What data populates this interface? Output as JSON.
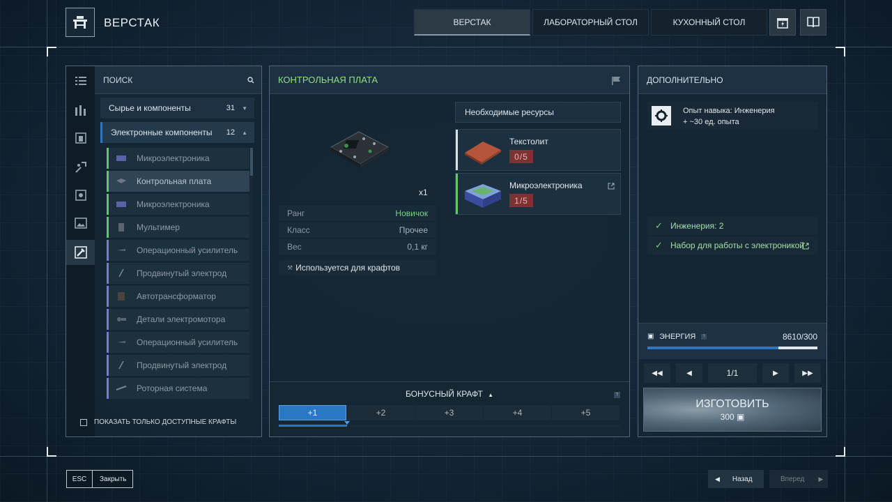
{
  "header": {
    "title": "ВЕРСТАК",
    "tabs": [
      {
        "label": "ВЕРСТАК",
        "active": true
      },
      {
        "label": "ЛАБОРАТОРНЫЙ СТОЛ",
        "active": false
      },
      {
        "label": "КУХОННЫЙ СТОЛ",
        "active": false
      }
    ],
    "icons": [
      "gift-energy-icon",
      "book-icon"
    ]
  },
  "left_panel": {
    "search_label": "ПОИСК",
    "categories": [
      {
        "label": "Сырье и компоненты",
        "count": "31",
        "expanded": false
      },
      {
        "label": "Электронные компоненты",
        "count": "12",
        "expanded": true
      }
    ],
    "items": [
      {
        "label": "Микроэлектроника",
        "rarity": "green",
        "selected": false
      },
      {
        "label": "Контрольная плата",
        "rarity": "green",
        "selected": true
      },
      {
        "label": "Микроэлектроника",
        "rarity": "green",
        "selected": false
      },
      {
        "label": "Мультимер",
        "rarity": "green",
        "selected": false
      },
      {
        "label": "Операционный усилитель",
        "rarity": "blue",
        "selected": false
      },
      {
        "label": "Продвинутый электрод",
        "rarity": "blue",
        "selected": false
      },
      {
        "label": "Автотрансформатор",
        "rarity": "blue",
        "selected": false
      },
      {
        "label": "Детали электромотора",
        "rarity": "blue",
        "selected": false
      },
      {
        "label": "Операционный усилитель",
        "rarity": "blue",
        "selected": false
      },
      {
        "label": "Продвинутый электрод",
        "rarity": "blue",
        "selected": false
      },
      {
        "label": "Роторная система",
        "rarity": "blue",
        "selected": false
      }
    ],
    "only_available_label": "ПОКАЗАТЬ ТОЛЬКО ДОСТУПНЫЕ КРАФТЫ",
    "only_available_checked": false
  },
  "center_panel": {
    "title": "КОНТРОЛЬНАЯ ПЛАТА",
    "quantity": "x1",
    "stats": [
      {
        "label": "Ранг",
        "value": "Новичок"
      },
      {
        "label": "Класс",
        "value": "Прочее"
      },
      {
        "label": "Вес",
        "value": "0,1 кг"
      }
    ],
    "used_for": "Используется для крафтов",
    "resources_header": "Необходимые ресурсы",
    "resources": [
      {
        "name": "Текстолит",
        "qty": "0/5",
        "bar_color": "#d9dfe3"
      },
      {
        "name": "Микроэлектроника",
        "qty": "1/5",
        "bar_color": "#5fc96a"
      }
    ],
    "bonus_label": "БОНУСНЫЙ КРАФТ",
    "bonus_tabs": [
      "+1",
      "+2",
      "+3",
      "+4",
      "+5"
    ],
    "bonus_active_index": 0,
    "bonus_progress": 0.2
  },
  "right_panel": {
    "title": "ДОПОЛНИТЕЛЬНО",
    "skill_line1": "Опыт навыка: Инженерия",
    "skill_line2": "+ ~30 ед. опыта",
    "requirements": [
      "Инженерия: 2",
      "Набор для работы с электроникой"
    ],
    "energy_label": "ЭНЕРГИЯ",
    "energy_value": "8610/300",
    "energy_fill": 0.77,
    "pager": "1/1",
    "make_label": "ИЗГОТОВИТЬ",
    "make_cost": "300"
  },
  "footer": {
    "esc_key": "ESC",
    "close_label": "Закрыть",
    "back_label": "Назад",
    "forward_label": "Вперед"
  },
  "colors": {
    "accent_green": "#7cd67f",
    "accent_blue": "#2a78c4",
    "rarity_green": "#5fc96a",
    "rarity_blue": "#7a79d8",
    "warning_red": "#7e3232"
  }
}
